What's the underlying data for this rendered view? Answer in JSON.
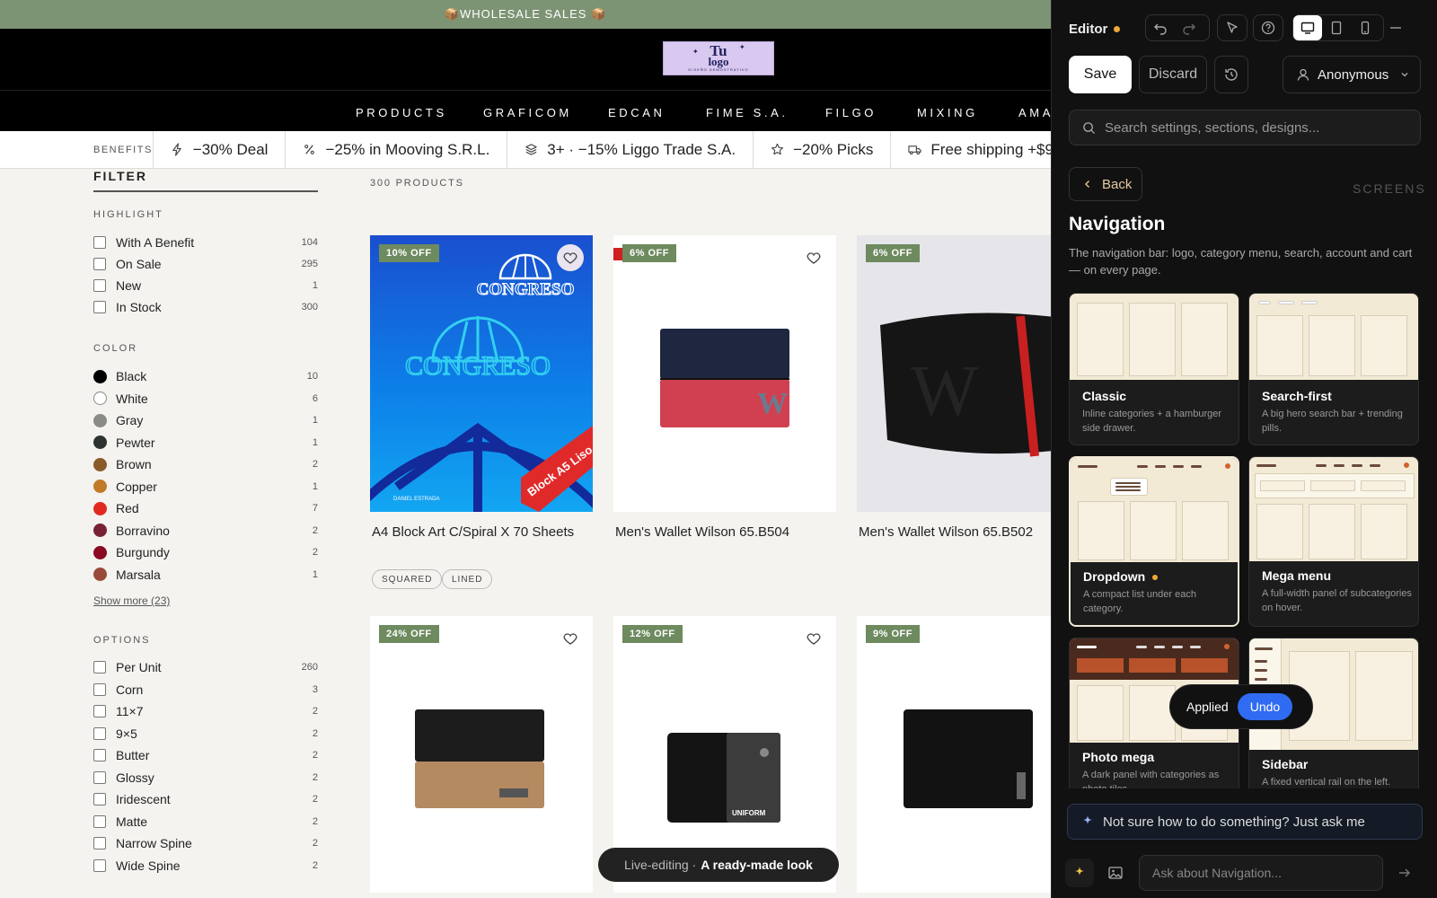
{
  "store": {
    "promo": "📦WHOLESALE SALES 📦",
    "logo": {
      "line1": "Tu",
      "line2": "logo",
      "line3": "DISEÑO DEMOSTRATIVO"
    },
    "nav": [
      "PRODUCTS",
      "GRAFICOM",
      "EDCAN",
      "FIME S.A.",
      "FILGO",
      "MIXING",
      "AMA"
    ],
    "benefits_label": "BENEFITS",
    "benefits": [
      {
        "icon": "bolt-icon",
        "text": "−30% Deal"
      },
      {
        "icon": "percent-icon",
        "text": "−25% in Mooving S.R.L."
      },
      {
        "icon": "layers-icon",
        "text": "3+ · −15% Liggo Trade S.A."
      },
      {
        "icon": "star-icon",
        "text": "−20% Picks"
      },
      {
        "icon": "truck-icon",
        "text": "Free shipping +$9"
      }
    ],
    "filter": {
      "title": "FILTER",
      "highlight_title": "HIGHLIGHT",
      "highlight": [
        {
          "label": "With A Benefit",
          "count": "104"
        },
        {
          "label": "On Sale",
          "count": "295"
        },
        {
          "label": "New",
          "count": "1"
        },
        {
          "label": "In Stock",
          "count": "300"
        }
      ],
      "color_title": "COLOR",
      "colors": [
        {
          "label": "Black",
          "count": "10",
          "swatch": "#000000"
        },
        {
          "label": "White",
          "count": "6",
          "swatch": "#ffffff"
        },
        {
          "label": "Gray",
          "count": "1",
          "swatch": "#8a8a86"
        },
        {
          "label": "Pewter",
          "count": "1",
          "swatch": "#2c3330"
        },
        {
          "label": "Brown",
          "count": "2",
          "swatch": "#8a5a2a"
        },
        {
          "label": "Copper",
          "count": "1",
          "swatch": "#c07a2a"
        },
        {
          "label": "Red",
          "count": "7",
          "swatch": "#e02a20"
        },
        {
          "label": "Borravino",
          "count": "2",
          "swatch": "#7a2035"
        },
        {
          "label": "Burgundy",
          "count": "2",
          "swatch": "#8a0a22"
        },
        {
          "label": "Marsala",
          "count": "1",
          "swatch": "#9a4a3a"
        }
      ],
      "show_more": "Show more (23)",
      "options_title": "OPTIONS",
      "options": [
        {
          "label": "Per Unit",
          "count": "260"
        },
        {
          "label": "Corn",
          "count": "3"
        },
        {
          "label": "11×7",
          "count": "2"
        },
        {
          "label": "9×5",
          "count": "2"
        },
        {
          "label": "Butter",
          "count": "2"
        },
        {
          "label": "Glossy",
          "count": "2"
        },
        {
          "label": "Iridescent",
          "count": "2"
        },
        {
          "label": "Matte",
          "count": "2"
        },
        {
          "label": "Narrow Spine",
          "count": "2"
        },
        {
          "label": "Wide Spine",
          "count": "2"
        }
      ]
    },
    "product_count": "300 PRODUCTS",
    "products": [
      {
        "name": "A4 Block Art C/Spiral X 70 Sheets",
        "badge": "10% OFF",
        "cover_text_1": "CONGRESO",
        "cover_text_2": "CONGRESO",
        "cover_sticker": "Block A5 Liso",
        "cover_footer": "DANIEL ESTRADA"
      },
      {
        "name": "Men's Wallet Wilson 65.B504",
        "badge": "6% OFF"
      },
      {
        "name": "Men's Wallet Wilson 65.B502",
        "badge": "6% OFF"
      },
      {
        "name": "",
        "badge": "24% OFF"
      },
      {
        "name": "",
        "badge": "12% OFF",
        "wallet_text": "UNIFORM"
      },
      {
        "name": "",
        "badge": "9% OFF"
      }
    ],
    "tags": [
      "SQUARED",
      "LINED"
    ],
    "live_pill": {
      "prefix": "Live-editing ·",
      "text": "A ready-made look"
    }
  },
  "editor": {
    "title": "Editor",
    "save": "Save",
    "discard": "Discard",
    "user": "Anonymous",
    "search_placeholder": "Search settings, sections, designs...",
    "back": "Back",
    "screens_label": "SCREENS",
    "section_title": "Navigation",
    "section_desc": "The navigation bar: logo, category menu, search, account and cart — on every page.",
    "designs": [
      {
        "title": "Classic",
        "desc": "Inline categories + a hamburger side drawer."
      },
      {
        "title": "Search-first",
        "desc": "A big hero search bar + trending pills."
      },
      {
        "title": "Dropdown",
        "desc": "A compact list under each category.",
        "selected": true
      },
      {
        "title": "Mega menu",
        "desc": "A full-width panel of subcategories on hover."
      },
      {
        "title": "Photo mega",
        "desc": "A dark panel with categories as photo tiles."
      },
      {
        "title": "Sidebar",
        "desc": "A fixed vertical rail on the left."
      }
    ],
    "toast": {
      "status": "Applied",
      "action": "Undo"
    },
    "ask_hint": "Not sure how to do something? Just ask me",
    "chat_placeholder": "Ask about Navigation..."
  }
}
